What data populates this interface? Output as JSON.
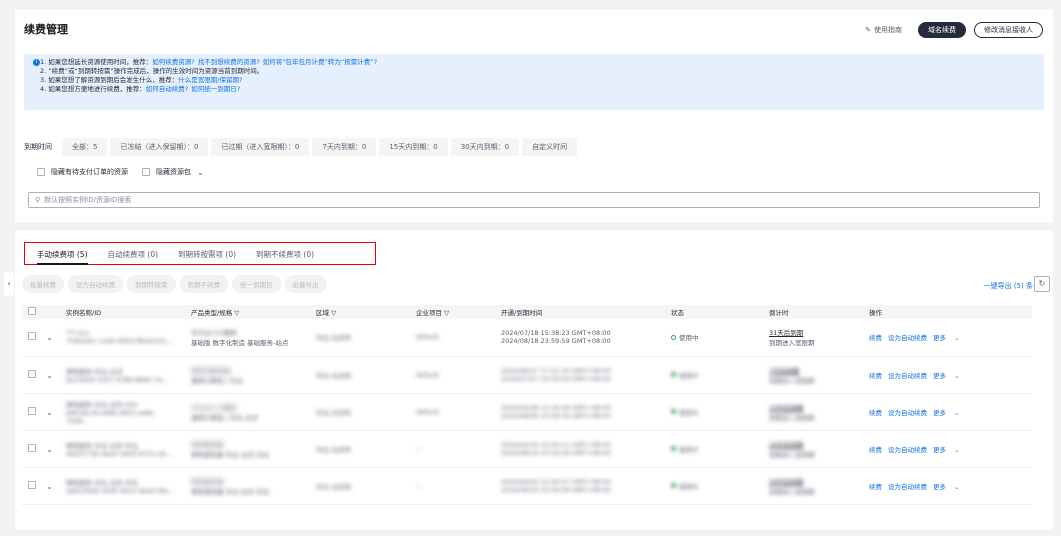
{
  "header": {
    "title": "续费管理",
    "guide": "使用指南",
    "btn_domain": "域名续费",
    "btn_receiver": "修改消息接收人"
  },
  "info": [
    {
      "text": "1. 如果您想延长资源使用时间，推荐：",
      "links": [
        "如何续费资源?",
        "找不到想续费的资源?",
        "如何将“包年包月计费”转为“按需计费”?"
      ]
    },
    {
      "text": "2. “续费”或“到期转按需”操作完成后，操作的生效时间为资源当前到期时间。",
      "links": []
    },
    {
      "text": "3. 如果您想了解资源到期后会发生什么，推荐：",
      "links": [
        "什么是宽限期/保留期?"
      ]
    },
    {
      "text": "4. 如果您想方便地进行续费，推荐：",
      "links": [
        "如何自动续费?",
        "如何统一到期日?"
      ]
    }
  ],
  "filters": {
    "label": "到期时间",
    "items": [
      "全部：5",
      "已冻结（进入保留期）：0",
      "已过期（进入宽限期）：0",
      "7天内到期：0",
      "15天内到期：0",
      "30天内到期：0",
      "自定义时间"
    ]
  },
  "checks": [
    "隐藏有待支付订单的资源",
    "隐藏资源包"
  ],
  "search": {
    "placeholder": "默认按照实例ID/资源ID搜索"
  },
  "tabs": [
    "手动续费项 (5)",
    "自动续费项 (0)",
    "到期转按需项 (0)",
    "到期不续费项 (0)"
  ],
  "toolbar": [
    "批量续费",
    "设为自动续费",
    "到期转按需",
    "到期不续费",
    "统一到期日",
    "批量导出"
  ],
  "export": "一键导出 (5) 条",
  "columns": [
    "实例名称/ID",
    "产品类型/规格",
    "区域",
    "企业项目",
    "开通/到期时间",
    "状态",
    "倒计时",
    "操作"
  ],
  "rows": [
    {
      "name": "***-ecs",
      "id": "7f3b4dec-1a4e-4d5d-9bad-b3c...",
      "type": "华为云CCE集群",
      "spec": "基础版 数字化制造 基础服务-站点",
      "region": "华北-北京四",
      "project": "default",
      "start": "2024/07/18 15:38:23 GMT+08:00",
      "end": "2024/08/18 23:59:59 GMT+08:00",
      "status": "使用中",
      "countdown": "31天后到期",
      "note": "到期进入宽限期",
      "ops": [
        "续费",
        "设为自动续费",
        "更多"
      ]
    },
    {
      "name": "弹性服务-华北-北京",
      "id": "ba230d3-3207-4789-8895-7d...",
      "type": "弹性云服务器",
      "spec": "通用计算型 | 华北",
      "region": "华北-北京四",
      "project": "default",
      "start": "2024/06/27 17:21:33 GMT+08:00",
      "end": "2024/07/27 23:59:59 GMT+08:00",
      "status": "使用中",
      "countdown": "7天后到期",
      "note": "到期进入宽限期",
      "ops": [
        "续费",
        "设为自动续费",
        "更多"
      ]
    },
    {
      "name": "弹性服务-华北-北京-400",
      "id": "b8018c19-a48e-4853-ae8c-7208...",
      "type": "华为云CCE集群",
      "spec": "通用计算型 | 华北-北京",
      "region": "华北-北京四",
      "project": "default",
      "start": "2024/05/06 12:34:56 GMT+08:00",
      "end": "2024/08/06 23:59:59 GMT+08:00",
      "status": "使用中",
      "countdown": "19天后到期",
      "note": "到期进入宽限期",
      "ops": [
        "续费",
        "设为自动续费",
        "更多"
      ]
    },
    {
      "name": "弹性服务-华北-北京-华北",
      "id": "4643172b-4e42-4900-b701-eb...",
      "type": "弹性服务器",
      "spec": "弹性服务器 华北-北京-华北",
      "region": "华北-北京四",
      "project": "--",
      "start": "2024/04/16 15:00:11 GMT+08:00",
      "end": "2024/08/16 23:59:59 GMT+08:00",
      "status": "使用中",
      "countdown": "29天后到期",
      "note": "到期进入宽限期",
      "ops": [
        "续费",
        "设为自动续费",
        "更多"
      ]
    },
    {
      "name": "弹性服务-华北-北京-华北",
      "id": "ad623946-4290-4641-8ad3-f6e...",
      "type": "弹性服务器",
      "spec": "弹性服务器 华北-北京-华北",
      "region": "华北-北京四",
      "project": "--",
      "start": "2024/04/16 15:00:27 GMT+08:00",
      "end": "2024/08/16 23:59:59 GMT+08:00",
      "status": "使用中",
      "countdown": "29天后到期",
      "note": "到期进入宽限期",
      "ops": [
        "续费",
        "设为自动续费",
        "更多"
      ]
    }
  ]
}
